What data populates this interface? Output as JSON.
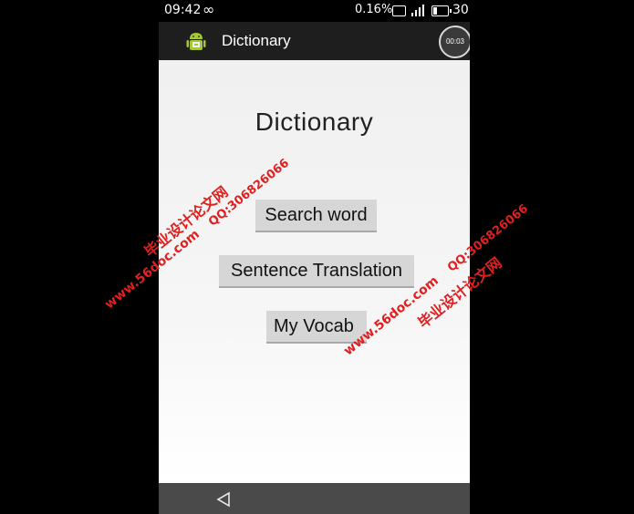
{
  "status_bar": {
    "time": "09:42",
    "infinity_symbol": "∞",
    "data_percent": "0.16%",
    "battery": "30"
  },
  "action_bar": {
    "app_icon": "android-icon",
    "title": "Dictionary",
    "timer": "00:03"
  },
  "main": {
    "title": "Dictionary",
    "buttons": {
      "search_word": "Search word",
      "sentence_translation": "Sentence Translation",
      "my_vocab": "My Vocab"
    }
  },
  "nav_bar": {
    "back_icon": "back-triangle-icon"
  },
  "watermarks": {
    "site_cn": "毕业设计论文网",
    "url": "www.56doc.com",
    "qq": "QQ:306826066"
  },
  "colors": {
    "watermark": "#e02020",
    "button_bg": "#d6d6d6",
    "action_bar": "#1e1e1e",
    "nav_bar": "#4a4a4a"
  }
}
